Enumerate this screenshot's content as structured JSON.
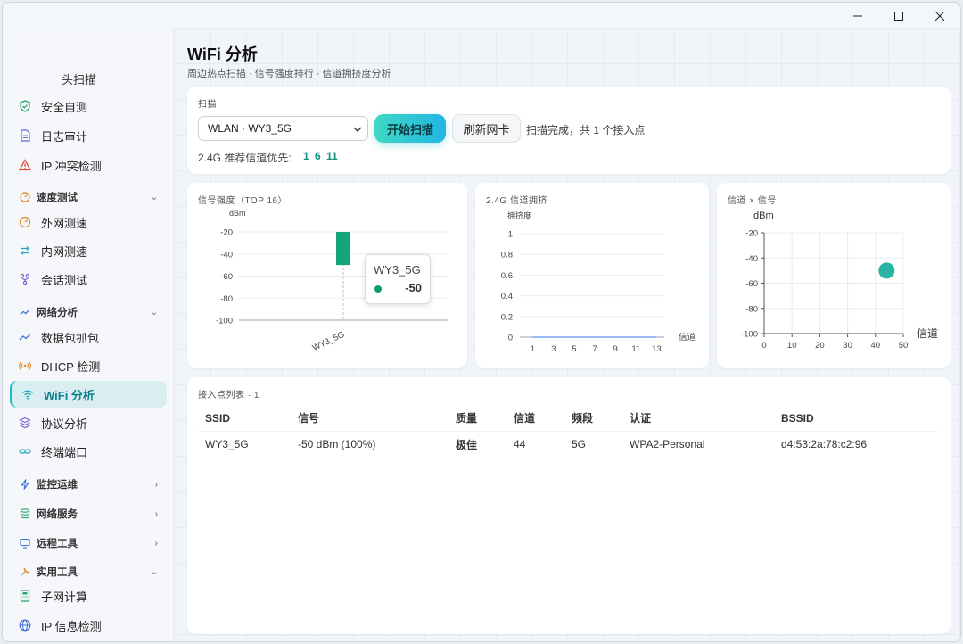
{
  "window": {
    "min_label": "—",
    "max_label": "☐",
    "close_label": "✕"
  },
  "sidebar": {
    "brand": "头扫描",
    "items_top": [
      {
        "label": "安全自测",
        "icon": "shield-check-icon"
      },
      {
        "label": "日志审计",
        "icon": "document-icon"
      },
      {
        "label": "IP 冲突检测",
        "icon": "warning-icon"
      }
    ],
    "groups": [
      {
        "label": "速度测试",
        "icon": "speedometer-icon",
        "expanded": true,
        "items": [
          {
            "label": "外网测速",
            "icon": "gauge-icon"
          },
          {
            "label": "内网测速",
            "icon": "swap-arrows-icon"
          },
          {
            "label": "会话测试",
            "icon": "branch-icon"
          }
        ]
      },
      {
        "label": "网络分析",
        "icon": "trend-icon",
        "expanded": true,
        "items": [
          {
            "label": "数据包抓包",
            "icon": "chart-line-icon"
          },
          {
            "label": "DHCP 检测",
            "icon": "broadcast-icon"
          },
          {
            "label": "WiFi 分析",
            "icon": "wifi-icon",
            "active": true
          },
          {
            "label": "协议分析",
            "icon": "layers-icon"
          },
          {
            "label": "终端端口",
            "icon": "link-icon"
          }
        ]
      },
      {
        "label": "监控运维",
        "icon": "bolt-icon",
        "expanded": false,
        "items": []
      },
      {
        "label": "网络服务",
        "icon": "database-icon",
        "expanded": false,
        "items": []
      },
      {
        "label": "远程工具",
        "icon": "monitor-icon",
        "expanded": false,
        "items": []
      },
      {
        "label": "实用工具",
        "icon": "tools-icon",
        "expanded": true,
        "items": [
          {
            "label": "子网计算",
            "icon": "calculator-icon"
          },
          {
            "label": "IP 信息检测",
            "icon": "globe-icon"
          }
        ]
      }
    ]
  },
  "header": {
    "title": "WiFi 分析",
    "subtitle": "周边热点扫描 · 信号强度排行 · 信道拥挤度分析"
  },
  "scan": {
    "label": "扫描",
    "adapter": "WLAN · WY3_5G",
    "start_button": "开始扫描",
    "refresh_button": "刷新网卡",
    "status": "扫描完成，共 1 个接入点",
    "recommend_label": "2.4G 推荐信道优先:",
    "recommend_channels": [
      "1",
      "6",
      "11"
    ]
  },
  "signal_chart_label": "信号强度（TOP 16）",
  "congestion_chart_label": "2.4G 信道拥挤",
  "scatter_chart_label": "信道 × 信号",
  "tooltip": {
    "name": "WY3_5G",
    "value": "-50",
    "color": "#0d9a6e"
  },
  "chart_data": [
    {
      "type": "bar",
      "title": "信号强度（TOP 16）",
      "ylabel": "dBm",
      "categories": [
        "WY3_5G"
      ],
      "values": [
        -50
      ],
      "ylim": [
        -100,
        -20
      ],
      "yticks": [
        "-20",
        "-40",
        "-60",
        "-80",
        "-100"
      ],
      "color": "#12a678",
      "grid": true
    },
    {
      "type": "line",
      "title": "2.4G 信道拥挤",
      "ylabel": "拥挤度",
      "xlabel": "信道",
      "x": [
        1,
        3,
        5,
        7,
        9,
        11,
        13
      ],
      "values": [
        0,
        0,
        0,
        0,
        0,
        0,
        0
      ],
      "ylim": [
        0,
        1
      ],
      "yticks": [
        "0",
        "0.2",
        "0.4",
        "0.6",
        "0.8",
        "1"
      ],
      "xticks": [
        "1",
        "3",
        "5",
        "7",
        "9",
        "11",
        "13"
      ],
      "grid": true
    },
    {
      "type": "scatter",
      "title": "信道 × 信号",
      "ylabel": "dBm",
      "xlabel": "信道",
      "points": [
        {
          "x": 44,
          "y": -50
        }
      ],
      "xlim": [
        0,
        50
      ],
      "ylim": [
        -100,
        -20
      ],
      "xticks": [
        "0",
        "10",
        "20",
        "30",
        "40",
        "50"
      ],
      "yticks": [
        "-20",
        "-40",
        "-60",
        "-80",
        "-100"
      ],
      "color": "#2bb3a3",
      "grid": true
    }
  ],
  "ap_list": {
    "label": "接入点列表 · 1",
    "columns": [
      "SSID",
      "信号",
      "质量",
      "信道",
      "频段",
      "认证",
      "BSSID"
    ],
    "rows": [
      [
        "WY3_5G",
        "-50 dBm (100%)",
        "极佳",
        "44",
        "5G",
        "WPA2-Personal",
        "d4:53:2a:78:c2:96"
      ]
    ]
  }
}
